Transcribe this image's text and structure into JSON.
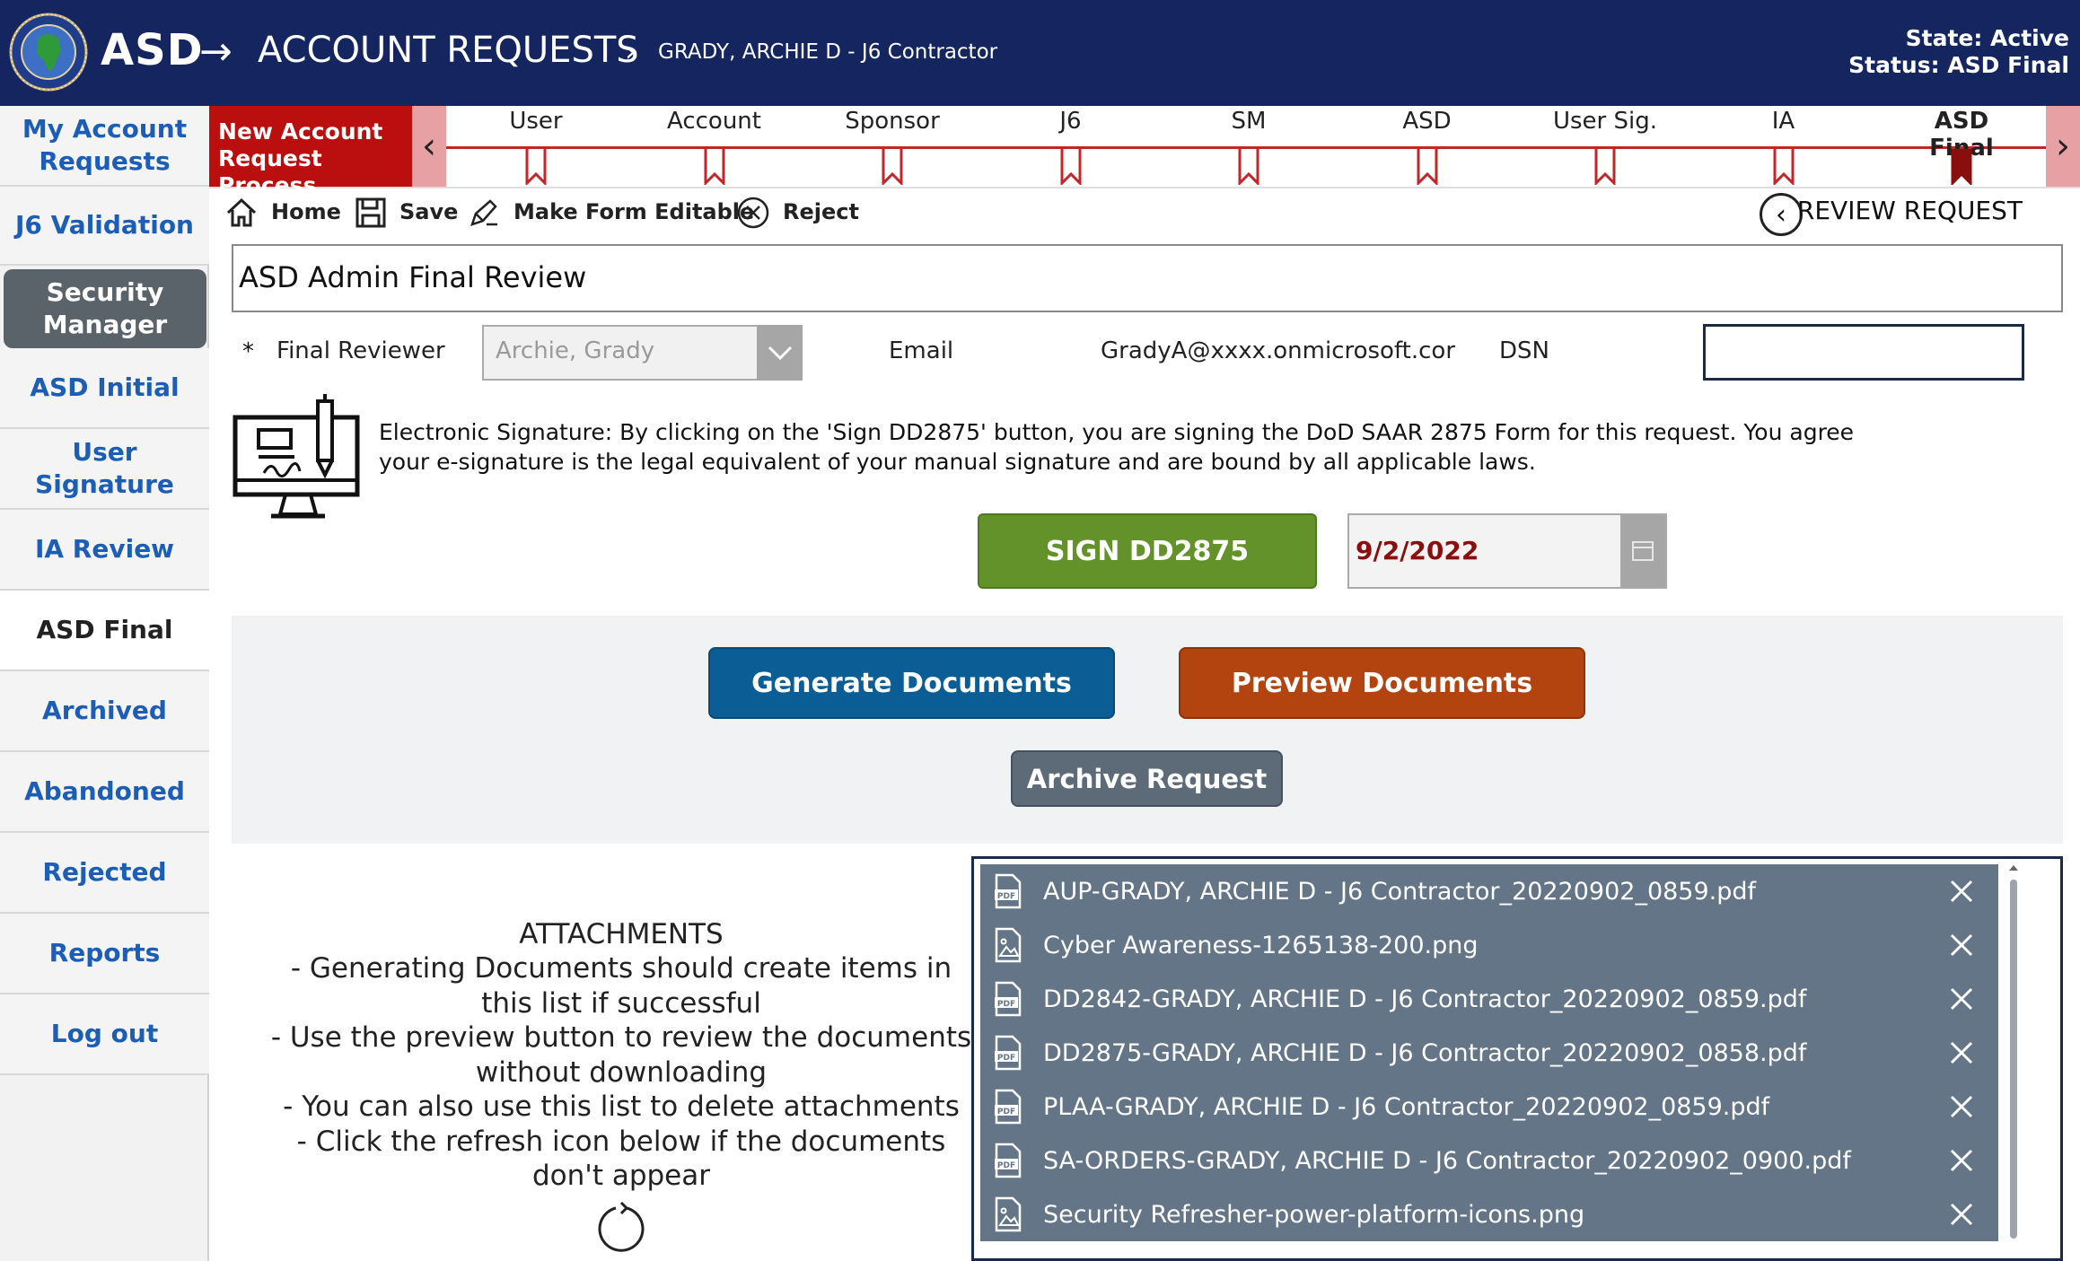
{
  "header": {
    "app_title": "ASD",
    "arrow": "→",
    "section_title": "ACCOUNT REQUESTS",
    "crumb_separator": "›",
    "crumb_user": "GRADY, ARCHIE D - J6 Contractor",
    "state": "State: Active",
    "status": "Status: ASD Final"
  },
  "sidebar": {
    "items": [
      {
        "label": "My Account Requests"
      },
      {
        "label": "J6 Validation"
      },
      {
        "label": "Security Manager"
      },
      {
        "label": "ASD Initial"
      },
      {
        "label": "User Signature"
      },
      {
        "label": "IA Review"
      },
      {
        "label": "ASD Final"
      },
      {
        "label": "Archived"
      },
      {
        "label": "Abandoned"
      },
      {
        "label": "Rejected"
      },
      {
        "label": "Reports"
      },
      {
        "label": "Log out"
      }
    ]
  },
  "process": {
    "new_label": "New Account Request Process",
    "steps": [
      "User",
      "Account",
      "Sponsor",
      "J6",
      "SM",
      "ASD",
      "User Sig.",
      "IA",
      "ASD Final"
    ],
    "current_step": "ASD Final"
  },
  "toolbar": {
    "home": "Home",
    "save": "Save",
    "edit": "Make Form Editable",
    "reject": "Reject",
    "review": "REVIEW REQUEST"
  },
  "form": {
    "title": "ASD Admin Final Review",
    "required_mark": "*",
    "final_reviewer_label": "Final Reviewer",
    "final_reviewer_value": "Archie, Grady",
    "email_label": "Email",
    "email_value": "GradyA@xxxx.onmicrosoft.cor",
    "dsn_label": "DSN",
    "dsn_value": "",
    "signature_text": "Electronic Signature: By clicking on the 'Sign DD2875' button, you are signing the DoD SAAR 2875 Form for this request.  You agree your e-signature is the legal equivalent of your manual signature and are bound by all applicable laws.",
    "sign_button": "SIGN DD2875",
    "sign_date": "9/2/2022"
  },
  "actions": {
    "generate": "Generate Documents",
    "preview": "Preview Documents",
    "archive": "Archive Request"
  },
  "attachments": {
    "note": "ATTACHMENTS\n- Generating Documents should create items in this list if successful\n- Use the preview button to review the documents without downloading\n- You can also use this list to delete attachments\n- Click the refresh icon below if the documents don't appear",
    "files": [
      {
        "name": "AUP-GRADY, ARCHIE D - J6 Contractor_20220902_0859.pdf",
        "icon": "pdf-icon"
      },
      {
        "name": "Cyber Awareness-1265138-200.png",
        "icon": "image-icon"
      },
      {
        "name": "DD2842-GRADY, ARCHIE D - J6 Contractor_20220902_0859.pdf",
        "icon": "pdf-icon"
      },
      {
        "name": "DD2875-GRADY, ARCHIE D - J6 Contractor_20220902_0858.pdf",
        "icon": "pdf-icon"
      },
      {
        "name": "PLAA-GRADY, ARCHIE D - J6 Contractor_20220902_0859.pdf",
        "icon": "pdf-icon"
      },
      {
        "name": "SA-ORDERS-GRADY, ARCHIE D - J6 Contractor_20220902_0900.pdf",
        "icon": "pdf-icon"
      },
      {
        "name": "Security Refresher-power-platform-icons.png",
        "icon": "image-icon"
      }
    ]
  },
  "colors": {
    "header_bg": "#14255f",
    "process_red": "#bb0e0e",
    "sign_green": "#63922b",
    "generate_blue": "#0b5d95",
    "preview_orange": "#b3430f",
    "archive_gray": "#5d6b78",
    "link_blue": "#1c5db5"
  }
}
